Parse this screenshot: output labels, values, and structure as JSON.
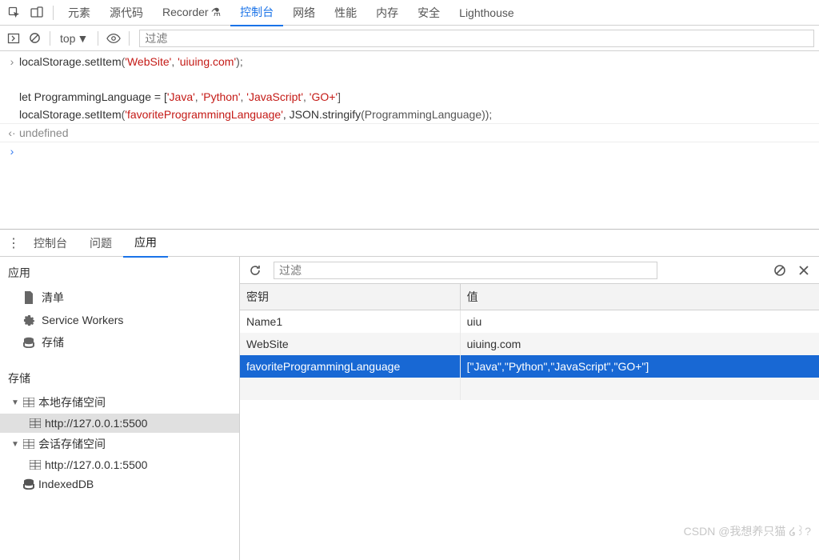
{
  "top_tabs": {
    "elements": "元素",
    "sources": "源代码",
    "recorder": "Recorder",
    "console": "控制台",
    "network": "网络",
    "performance": "性能",
    "memory": "内存",
    "security": "安全",
    "lighthouse": "Lighthouse"
  },
  "console_toolbar": {
    "context": "top",
    "filter_placeholder": "过滤"
  },
  "console": {
    "pre1": "localStorage.",
    "m1": "setItem",
    "p1": "(",
    "s1": "'WebSite'",
    "c1": ", ",
    "s2": "'uiuing.com'",
    "p2": ");",
    "l2a": "let",
    "l2b": " ProgrammingLanguage = [",
    "l2s1": "'Java'",
    "l2c1": ", ",
    "l2s2": "'Python'",
    "l2c2": ", ",
    "l2s3": "'JavaScript'",
    "l2c3": ", ",
    "l2s4": "'GO+'",
    "l2e": "]",
    "l3a": "localStorage.",
    "l3m": "setItem",
    "l3p1": "(",
    "l3s1": "'favoriteProgrammingLanguage'",
    "l3c1": ", JSON.",
    "l3m2": "stringify",
    "l3p2": "(ProgrammingLanguage));",
    "result": "undefined"
  },
  "drawer_tabs": {
    "console": "控制台",
    "issues": "问题",
    "application": "应用"
  },
  "sidebar": {
    "app_header": "应用",
    "manifest": "清单",
    "sw": "Service Workers",
    "storage": "存储",
    "storage_header": "存储",
    "local_storage": "本地存储空间",
    "local_origin": "http://127.0.0.1:5500",
    "session_storage": "会话存储空间",
    "session_origin": "http://127.0.0.1:5500",
    "indexeddb": "IndexedDB"
  },
  "storage_panel": {
    "filter_placeholder": "过滤",
    "col_key": "密钥",
    "col_value": "值",
    "rows": [
      {
        "k": "Name1",
        "v": "uiu"
      },
      {
        "k": "WebSite",
        "v": "uiuing.com"
      },
      {
        "k": "favoriteProgrammingLanguage",
        "v": "[\"Java\",\"Python\",\"JavaScript\",\"GO+\"]"
      }
    ]
  },
  "watermark": "CSDN @我想养只猫 ໒꒱?"
}
